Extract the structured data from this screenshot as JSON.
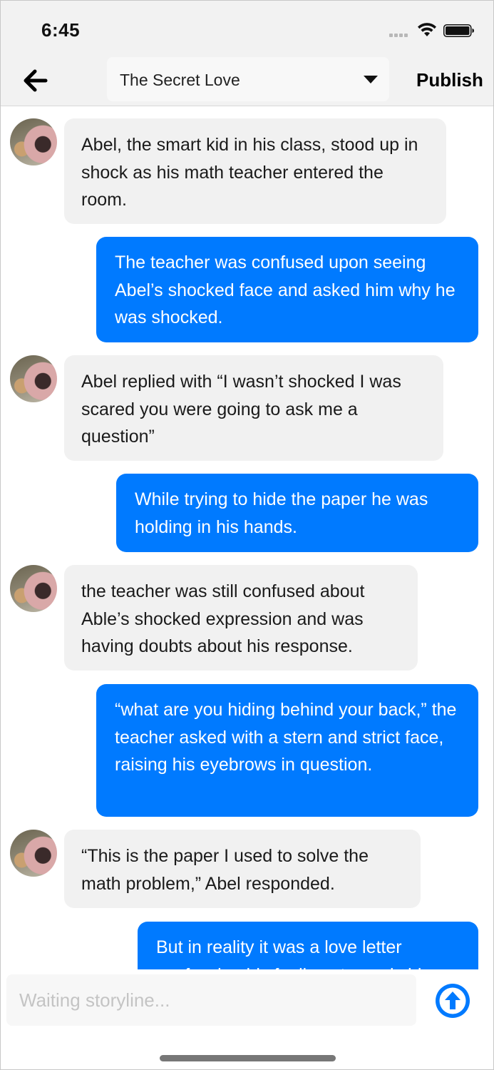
{
  "status_bar": {
    "time": "6:45"
  },
  "header": {
    "title": "The Secret Love",
    "publish_label": "Publish"
  },
  "messages": [
    {
      "side": "left",
      "text": "Abel, the smart kid in his class, stood up in shock as his math teacher entered the room."
    },
    {
      "side": "right",
      "text": "The teacher was confused upon seeing Abel’s shocked face and asked him why he was shocked."
    },
    {
      "side": "left",
      "text": "Abel replied with “I wasn’t shocked I was scared you were going to ask me a question”"
    },
    {
      "side": "right",
      "text": "While trying to hide the paper he was holding in his hands."
    },
    {
      "side": "left",
      "text": "the teacher was still confused about Able’s shocked expression and was having doubts about his response."
    },
    {
      "side": "right",
      "text": "“what are you hiding behind your back,” the teacher asked with a stern and strict face, raising his eyebrows in question."
    },
    {
      "side": "left",
      "text": "“This is the paper I used to solve the math problem,” Abel responded."
    },
    {
      "side": "right",
      "text": "But in reality it was a love letter confessing his feelings towards his"
    }
  ],
  "input": {
    "placeholder": "Waiting storyline..."
  },
  "colors": {
    "outgoing_bubble": "#007aff",
    "incoming_bubble": "#f1f1f1",
    "header_bg": "#f2f2f2"
  }
}
